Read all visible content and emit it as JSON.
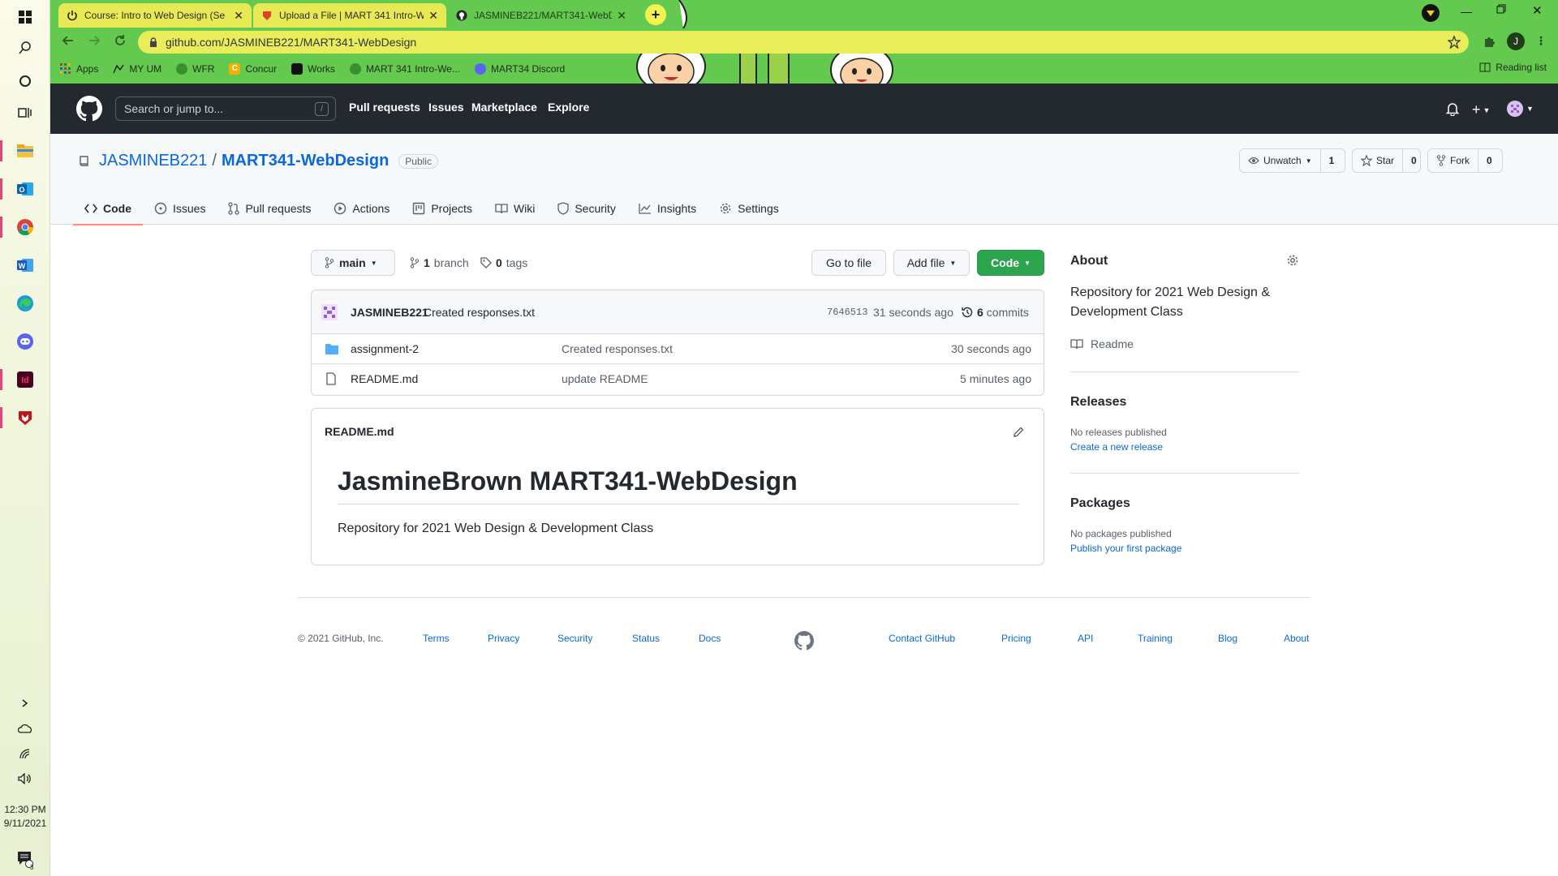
{
  "taskbar": {
    "clock_time": "12:30 PM",
    "clock_date": "9/11/2021",
    "notification_count": "3"
  },
  "browser": {
    "tabs": [
      {
        "label": "Course: Intro to Web Design (Se"
      },
      {
        "label": "Upload a File | MART 341 Intro-W"
      },
      {
        "label": "JASMINEB221/MART341-WebDe"
      }
    ],
    "url": "github.com/JASMINEB221/MART341-WebDesign",
    "profile_initial": "J",
    "bookmarks": [
      {
        "label": "Apps"
      },
      {
        "label": "MY UM"
      },
      {
        "label": "WFR"
      },
      {
        "label": "Concur"
      },
      {
        "label": "Works"
      },
      {
        "label": "MART 341 Intro-We..."
      },
      {
        "label": "MART34 Discord"
      }
    ],
    "reading_list": "Reading list"
  },
  "gh": {
    "search_placeholder": "Search or jump to...",
    "search_key": "/",
    "nav": [
      "Pull requests",
      "Issues",
      "Marketplace",
      "Explore"
    ]
  },
  "repo": {
    "owner": "JASMINEB221",
    "separator": "/",
    "name": "MART341-WebDesign",
    "visibility": "Public",
    "unwatch_label": "Unwatch",
    "watch_count": "1",
    "star_label": "Star",
    "star_count": "0",
    "fork_label": "Fork",
    "fork_count": "0",
    "tabs": [
      "Code",
      "Issues",
      "Pull requests",
      "Actions",
      "Projects",
      "Wiki",
      "Security",
      "Insights",
      "Settings"
    ]
  },
  "code": {
    "branch": "main",
    "branch_count": "1",
    "branch_label": "branch",
    "tag_count": "0",
    "tag_label": "tags",
    "go_to_file": "Go to file",
    "add_file": "Add file",
    "code_button": "Code",
    "commit": {
      "author": "JASMINEB221",
      "message": "Created responses.txt",
      "sha": "7646513",
      "time": "31 seconds ago",
      "count": "6",
      "count_label": "commits"
    },
    "files": [
      {
        "name": "assignment-2",
        "message": "Created responses.txt",
        "age": "30 seconds ago",
        "type": "folder"
      },
      {
        "name": "README.md",
        "message": "update README",
        "age": "5 minutes ago",
        "type": "file"
      }
    ]
  },
  "readme": {
    "filename": "README.md",
    "heading": "JasmineBrown MART341-WebDesign",
    "body": "Repository for 2021 Web Design & Development Class"
  },
  "about": {
    "title": "About",
    "description": "Repository for 2021 Web Design & Development Class",
    "readme_link": "Readme",
    "releases_title": "Releases",
    "releases_text": "No releases published",
    "releases_link": "Create a new release",
    "packages_title": "Packages",
    "packages_text": "No packages published",
    "packages_link": "Publish your first package"
  },
  "footer": {
    "copyright": "© 2021 GitHub, Inc.",
    "left_links": [
      "Terms",
      "Privacy",
      "Security",
      "Status",
      "Docs"
    ],
    "right_links": [
      "Contact GitHub",
      "Pricing",
      "API",
      "Training",
      "Blog",
      "About"
    ]
  },
  "colors": {
    "chrome_theme": "#63c94f",
    "tab_yellow": "#e8ea55",
    "gh_header": "#24292f",
    "link": "#0969da",
    "green_button": "#2da44e",
    "tab_underline": "#fd8c73"
  }
}
